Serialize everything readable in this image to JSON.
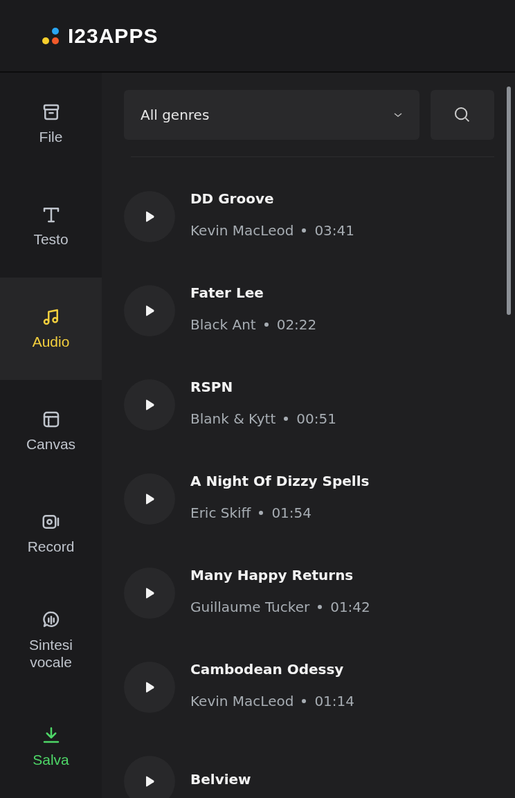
{
  "header": {
    "logo_text": "I23APPS"
  },
  "sidebar": {
    "items": [
      {
        "label": "File",
        "kind": "nav",
        "selected": false
      },
      {
        "label": "Testo",
        "kind": "nav",
        "selected": false
      },
      {
        "label": "Audio",
        "kind": "nav",
        "selected": true
      },
      {
        "label": "Canvas",
        "kind": "nav",
        "selected": false
      },
      {
        "label": "Record",
        "kind": "nav",
        "selected": false
      },
      {
        "label": "Sintesi vocale",
        "kind": "nav",
        "selected": false
      },
      {
        "label": "Salva",
        "kind": "action",
        "selected": false
      }
    ]
  },
  "filter": {
    "genre_value": "All genres"
  },
  "tracks": [
    {
      "title": "DD Groove",
      "artist": "Kevin MacLeod",
      "duration": "03:41"
    },
    {
      "title": "Fater Lee",
      "artist": "Black Ant",
      "duration": "02:22"
    },
    {
      "title": "RSPN",
      "artist": "Blank & Kytt",
      "duration": "00:51"
    },
    {
      "title": "A Night Of Dizzy Spells",
      "artist": "Eric Skiff",
      "duration": "01:54"
    },
    {
      "title": "Many Happy Returns",
      "artist": "Guillaume Tucker",
      "duration": "01:42"
    },
    {
      "title": "Cambodean Odessy",
      "artist": "Kevin MacLeod",
      "duration": "01:14"
    },
    {
      "title": "Belview"
    }
  ]
}
